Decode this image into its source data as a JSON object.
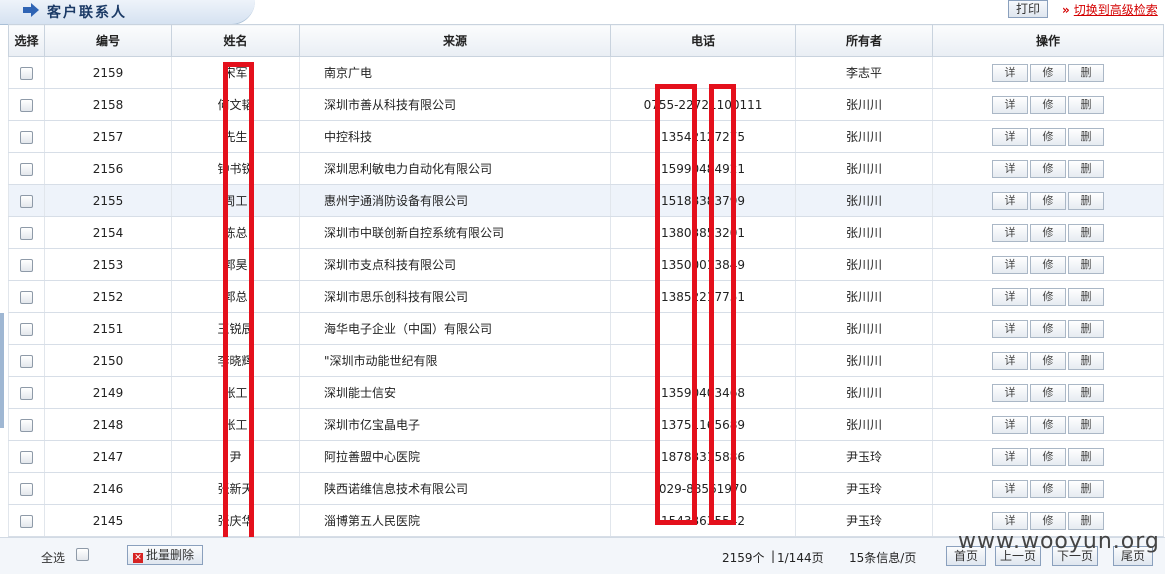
{
  "header": {
    "title": "客户联系人",
    "print_label": "打印",
    "advanced_search_link": "切换到高级检索",
    "advanced_search_arrow": "»"
  },
  "table": {
    "columns": [
      "选择",
      "编号",
      "姓名",
      "来源",
      "电话",
      "所有者",
      "操作"
    ],
    "rows": [
      {
        "id": "2159",
        "name": "宋军",
        "source": "南京广电",
        "phone": "",
        "owner": "李志平"
      },
      {
        "id": "2158",
        "name": "何文韬",
        "source": "深圳市善从科技有限公司",
        "phone": "0755-22721100111",
        "owner": "张川川"
      },
      {
        "id": "2157",
        "name": "先生",
        "source": "中控科技",
        "phone": "13542127275",
        "owner": "张川川"
      },
      {
        "id": "2156",
        "name": "钟书锐",
        "source": "深圳思利敏电力自动化有限公司",
        "phone": "15990484921",
        "owner": "张川川"
      },
      {
        "id": "2155",
        "name": "周工",
        "source": "惠州宇通消防设备有限公司",
        "phone": "15188383799",
        "owner": "张川川"
      },
      {
        "id": "2154",
        "name": "陈总",
        "source": "深圳市中联创新自控系统有限公司",
        "phone": "13803853201",
        "owner": "张川川"
      },
      {
        "id": "2153",
        "name": "郭昊",
        "source": "深圳市支点科技有限公司",
        "phone": "13500013849",
        "owner": "张川川"
      },
      {
        "id": "2152",
        "name": "郭总",
        "source": "深圳市思乐创科技有限公司",
        "phone": "13852217751",
        "owner": "张川川"
      },
      {
        "id": "2151",
        "name": "王锐辰",
        "source": "海华电子企业（中国）有限公司",
        "phone": "",
        "owner": "张川川"
      },
      {
        "id": "2150",
        "name": "李晓辉",
        "source": "\"深圳市动能世纪有限",
        "phone": "",
        "owner": "张川川"
      },
      {
        "id": "2149",
        "name": "张工",
        "source": "深圳能士信安",
        "phone": "13590403468",
        "owner": "张川川"
      },
      {
        "id": "2148",
        "name": "张工",
        "source": "深圳市亿宝晶电子",
        "phone": "13751165689",
        "owner": "张川川"
      },
      {
        "id": "2147",
        "name": "尹",
        "source": "阿拉善盟中心医院",
        "phone": "18783315886",
        "owner": "尹玉玲"
      },
      {
        "id": "2146",
        "name": "张新天",
        "source": "陕西诺维信息技术有限公司",
        "phone": "029-88561970",
        "owner": "尹玉玲"
      },
      {
        "id": "2145",
        "name": "张庆华",
        "source": "淄博第五人民医院",
        "phone": "15433635542",
        "owner": "尹玉玲"
      }
    ],
    "actions": {
      "detail": "详",
      "edit": "修",
      "delete": "删"
    }
  },
  "footer": {
    "select_all_label": "全选",
    "batch_delete_label": "批量删除",
    "total_count": "2159个",
    "page_indicator": "1/144页",
    "per_page": "15条信息/页",
    "first_page": "首页",
    "prev_page": "上一页",
    "next_page": "下一页",
    "last_page": "尾页"
  },
  "watermark": "www.wooyun.org",
  "colors": {
    "redaction": "#e4101c",
    "header_title": "#1b3a66",
    "link_red": "#d40000"
  }
}
